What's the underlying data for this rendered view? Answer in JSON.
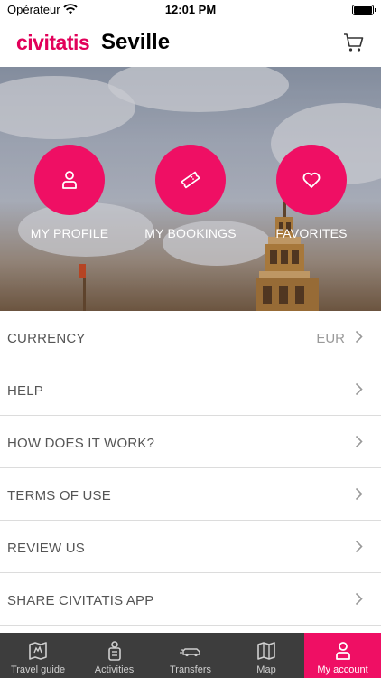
{
  "status_bar": {
    "carrier": "Opérateur",
    "time": "12:01 PM"
  },
  "header": {
    "brand": "civitatis",
    "city": "Seville"
  },
  "hero": {
    "buttons": [
      {
        "label": "MY PROFILE",
        "icon": "person-icon"
      },
      {
        "label": "MY BOOKINGS",
        "icon": "ticket-icon"
      },
      {
        "label": "FAVORITES",
        "icon": "heart-icon"
      }
    ]
  },
  "menu": {
    "items": [
      {
        "label": "CURRENCY",
        "value": "EUR"
      },
      {
        "label": "HELP"
      },
      {
        "label": "HOW DOES IT WORK?"
      },
      {
        "label": "TERMS OF USE"
      },
      {
        "label": "REVIEW US"
      },
      {
        "label": "SHARE CIVITATIS APP"
      }
    ]
  },
  "tabbar": {
    "tabs": [
      {
        "label": "Travel guide",
        "icon": "guide-book-icon"
      },
      {
        "label": "Activities",
        "icon": "activities-icon"
      },
      {
        "label": "Transfers",
        "icon": "transfers-car-icon"
      },
      {
        "label": "Map",
        "icon": "map-icon"
      },
      {
        "label": "My account",
        "icon": "account-icon"
      }
    ],
    "active": "My account"
  },
  "colors": {
    "accent": "#ef0f64",
    "brand": "#e2005a",
    "tabbar_bg": "#3d3d3d"
  }
}
